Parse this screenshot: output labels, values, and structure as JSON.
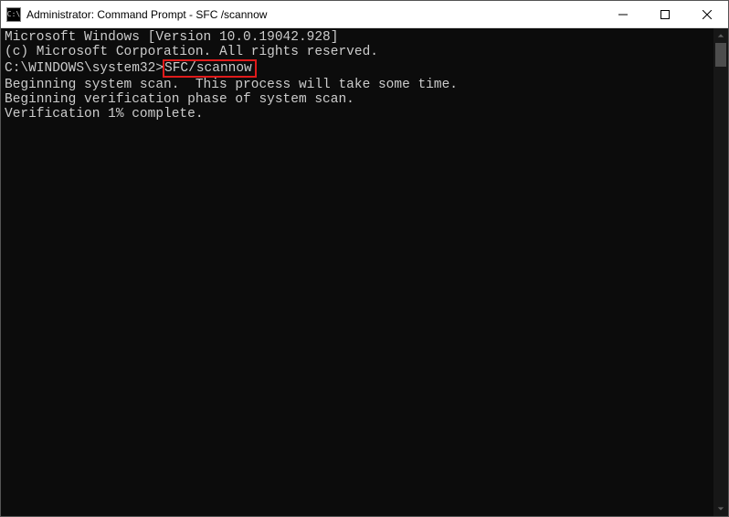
{
  "titlebar": {
    "icon_label": "C:\\",
    "title": "Administrator: Command Prompt - SFC /scannow"
  },
  "terminal": {
    "line1": "Microsoft Windows [Version 10.0.19042.928]",
    "line2": "(c) Microsoft Corporation. All rights reserved.",
    "blank1": "",
    "prompt": "C:\\WINDOWS\\system32>",
    "command": "SFC/scannow",
    "blank2": "",
    "line3": "Beginning system scan.  This process will take some time.",
    "blank3": "",
    "line4": "Beginning verification phase of system scan.",
    "line5": "Verification 1% complete."
  }
}
